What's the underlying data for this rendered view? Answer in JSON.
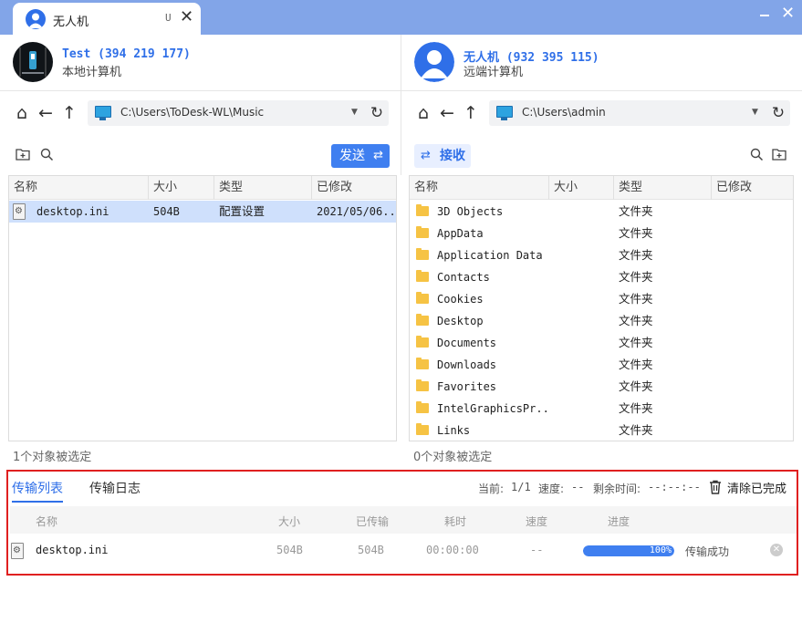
{
  "tab": {
    "title": "无人机",
    "badge": "U",
    "close": "✕"
  },
  "window": {
    "close": "✕"
  },
  "local": {
    "name": "Test (394 219 177)",
    "sub": "本地计算机",
    "path": "C:\\Users\\ToDesk-WL\\Music",
    "send_label": "发送",
    "status": "1个对象被选定",
    "columns": [
      "名称",
      "大小",
      "类型",
      "已修改"
    ],
    "rows": [
      {
        "name": "desktop.ini",
        "size": "504B",
        "type": "配置设置",
        "modified": "2021/05/06..."
      }
    ]
  },
  "remote": {
    "name": "无人机 (932 395 115)",
    "sub": "远端计算机",
    "path": "C:\\Users\\admin",
    "recv_label": "接收",
    "status": "0个对象被选定",
    "columns": [
      "名称",
      "大小",
      "类型",
      "已修改"
    ],
    "rows": [
      {
        "name": "3D Objects",
        "type": "文件夹"
      },
      {
        "name": "AppData",
        "type": "文件夹"
      },
      {
        "name": "Application Data",
        "type": "文件夹"
      },
      {
        "name": "Contacts",
        "type": "文件夹"
      },
      {
        "name": "Cookies",
        "type": "文件夹"
      },
      {
        "name": "Desktop",
        "type": "文件夹"
      },
      {
        "name": "Documents",
        "type": "文件夹"
      },
      {
        "name": "Downloads",
        "type": "文件夹"
      },
      {
        "name": "Favorites",
        "type": "文件夹"
      },
      {
        "name": "IntelGraphicsPr...",
        "type": "文件夹"
      },
      {
        "name": "Links",
        "type": "文件夹"
      }
    ]
  },
  "transfer": {
    "tab_list": "传输列表",
    "tab_log": "传输日志",
    "current_label": "当前:",
    "current_value": "1/1",
    "speed_label": "速度:",
    "speed_value": "--",
    "remaining_label": "剩余时间:",
    "remaining_value": "--:--:--",
    "clear_label": "清除已完成",
    "columns": [
      "名称",
      "大小",
      "已传输",
      "耗时",
      "速度",
      "进度"
    ],
    "rows": [
      {
        "name": "desktop.ini",
        "size": "504B",
        "transferred": "504B",
        "elapsed": "00:00:00",
        "speed": "--",
        "progress_value": 100,
        "progress_label": "100%",
        "status": "传输成功"
      }
    ]
  },
  "colors": {
    "accent": "#3f7ff0",
    "titlebar": "#82a5e8",
    "highlight_border": "#e02020"
  }
}
